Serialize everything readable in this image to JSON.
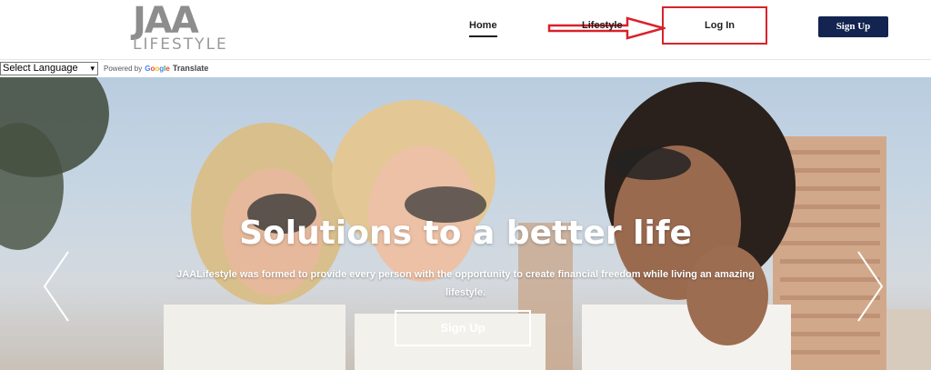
{
  "header": {
    "logo": {
      "mark": "JAA",
      "word": "LIFESTYLE"
    },
    "nav": {
      "home": "Home",
      "lifestyle": "Lifestyle",
      "login": "Log In"
    },
    "signup_label": "Sign Up"
  },
  "translate": {
    "select_value": "Select Language",
    "powered_by": "Powered by",
    "google": [
      "G",
      "o",
      "o",
      "g",
      "l",
      "e"
    ],
    "translate_label": "Translate"
  },
  "hero": {
    "title": "Solutions to a better life",
    "subtitle": "JAALifestyle was formed to provide every person with the opportunity to create financial freedom while living an amazing lifestyle.",
    "button_label": "Sign Up"
  },
  "colors": {
    "brand_navy": "#132450",
    "annotation_red": "#d9222a",
    "logo_gray": "#8d8d8d"
  }
}
